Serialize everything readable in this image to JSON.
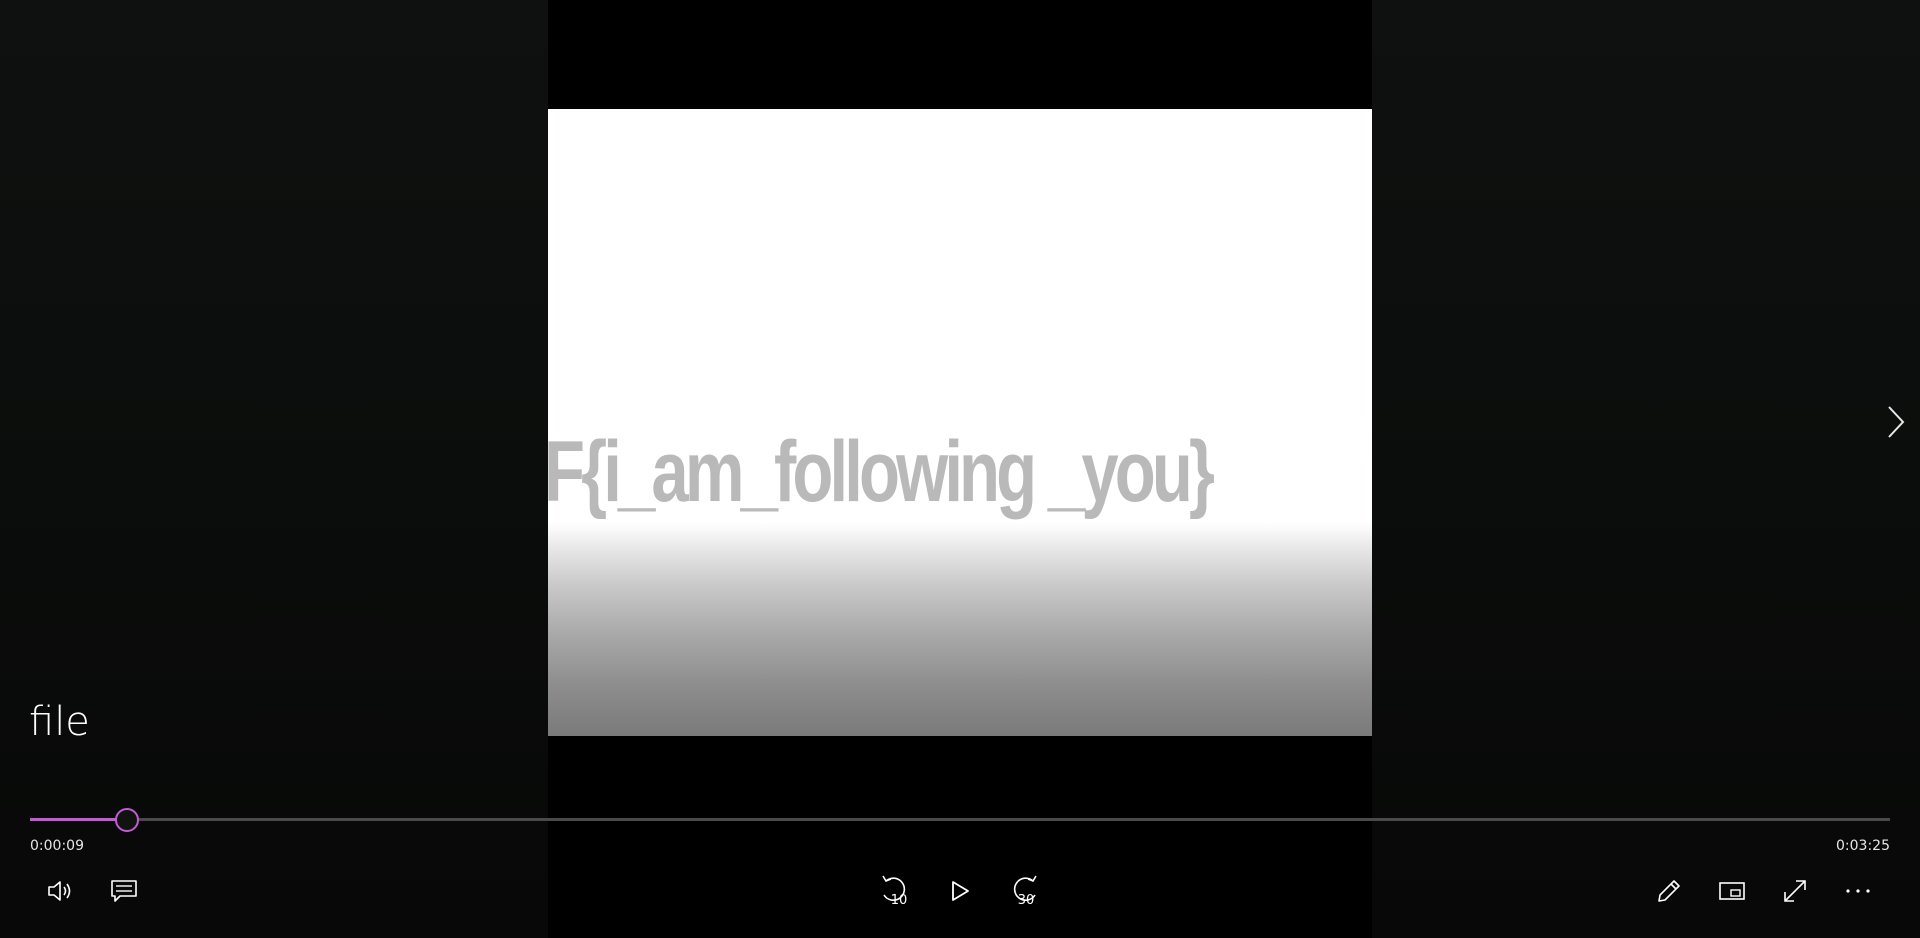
{
  "video": {
    "title": "file",
    "frame_text": "F{i_am_following _you}"
  },
  "playback": {
    "current_time": "0:00:09",
    "total_time": "0:03:25",
    "progress": 0.052
  },
  "controls": {
    "skip_back_seconds": "10",
    "skip_forward_seconds": "30"
  },
  "colors": {
    "accent": "#c45ad6",
    "background": "#0b0d0c",
    "track": "#4a4a4a"
  },
  "icons": {
    "volume": "volume-icon",
    "captions": "captions-icon",
    "skip_back": "skip-back-10-icon",
    "play": "play-icon",
    "skip_forward": "skip-forward-30-icon",
    "edit": "pencil-icon",
    "mini_view": "mini-view-icon",
    "fullscreen": "fullscreen-icon",
    "more": "more-icon",
    "next": "chevron-right-icon"
  }
}
